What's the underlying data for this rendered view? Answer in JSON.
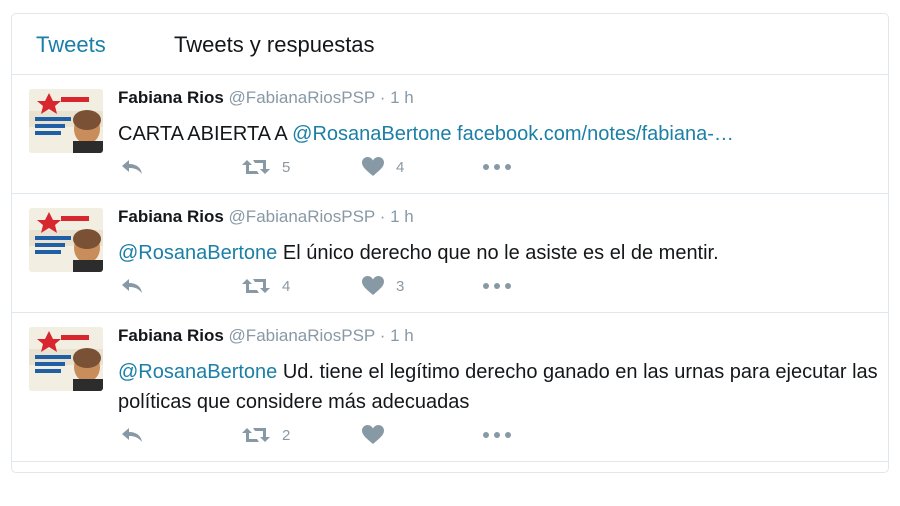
{
  "tabs": [
    {
      "label": "Tweets",
      "active": true
    },
    {
      "label": "Tweets y respuestas",
      "active": false
    }
  ],
  "colors": {
    "accent": "#1b7fa6",
    "muted": "#8899a6",
    "border": "#e1e8ed"
  },
  "tweets": [
    {
      "name": "Fabiana Rios",
      "handle": "@FabianaRiosPSP",
      "time": "1 h",
      "text_prefix": "CARTA ABIERTA A ",
      "mention": "@RosanaBertone",
      "text_suffix": " ",
      "link": "facebook.com/notes/fabiana-…",
      "retweets": "5",
      "likes": "4"
    },
    {
      "name": "Fabiana Rios",
      "handle": "@FabianaRiosPSP",
      "time": "1 h",
      "text_prefix": "",
      "mention": "@RosanaBertone",
      "text_suffix": " El único derecho que no le asiste es el de mentir.",
      "link": "",
      "retweets": "4",
      "likes": "3"
    },
    {
      "name": "Fabiana Rios",
      "handle": "@FabianaRiosPSP",
      "time": "1 h",
      "text_prefix": "",
      "mention": "@RosanaBertone",
      "text_suffix": " Ud. tiene el legítimo derecho ganado en las urnas para ejecutar las políticas que considere más adecuadas",
      "link": "",
      "retweets": "2",
      "likes": ""
    }
  ],
  "icons": {
    "reply": "reply-icon",
    "retweet": "retweet-icon",
    "like": "heart-icon",
    "more": "more-icon",
    "avatar": "avatar-image"
  }
}
